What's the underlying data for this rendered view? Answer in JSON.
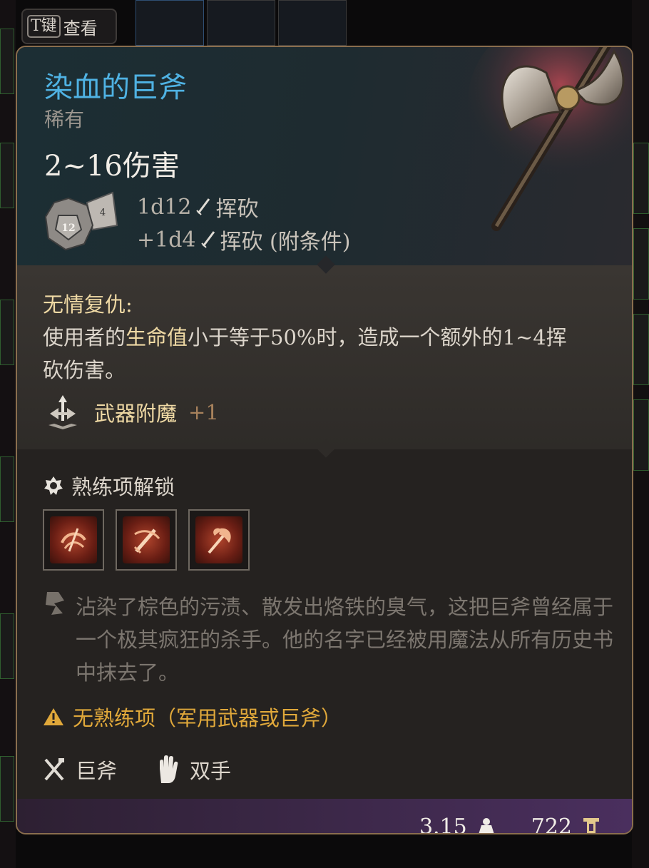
{
  "hotkey": {
    "key": "T键",
    "label": "查看"
  },
  "item": {
    "name": "染血的巨斧",
    "rarity": "稀有",
    "damage_total": "2~16伤害",
    "damage_lines": [
      {
        "dice": "1d12",
        "type": "挥砍"
      },
      {
        "dice": "+1d4",
        "type": "挥砍 (附条件)"
      }
    ],
    "dice_icon_numbers": [
      "12",
      "4"
    ]
  },
  "passive": {
    "name": "无情复仇:",
    "desc_pre": "使用者的",
    "desc_hl": "生命值",
    "desc_post": "小于等于50%时，造成一个额外的1~4挥砍伤害。"
  },
  "enchant": {
    "label": "武器附魔",
    "value": "+1"
  },
  "proficiency": {
    "title": "熟练项解锁",
    "icons": [
      "proficiency-action-icon-1",
      "proficiency-action-icon-2",
      "proficiency-action-icon-3"
    ]
  },
  "lore": "沾染了棕色的污渍、散发出烙铁的臭气，这把巨斧曾经属于一个极其疯狂的杀手。他的名字已经被用魔法从所有历史书中抹去了。",
  "warning": "无熟练项（军用武器或巨斧）",
  "tags": {
    "weapon_type": "巨斧",
    "handedness": "双手"
  },
  "footer": {
    "weight": "3.15",
    "value": "722"
  },
  "colors": {
    "title": "#4fb2e3",
    "rarity": "#9a958e",
    "passive_name": "#efd9a4",
    "warning": "#e0a83a",
    "panel_border": "#8a6e4e"
  }
}
